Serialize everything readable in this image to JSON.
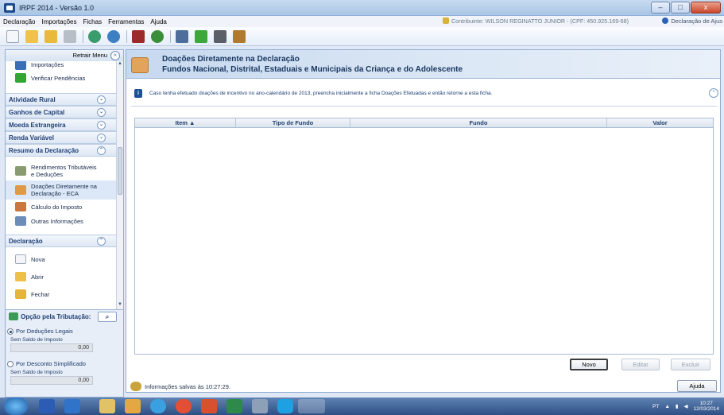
{
  "window": {
    "title": "IRPF 2014 - Versão 1.0",
    "min": "–",
    "max": "□",
    "close": "x"
  },
  "menu": {
    "items": [
      "Declaração",
      "Importações",
      "Fichas",
      "Ferramentas",
      "Ajuda"
    ],
    "contribuinte": "Contribuinte: WILSON REGINATTO JUNIOR - (CPF: 450.925.169-68)",
    "declaracao_ajuste": "Declaração de Ajus"
  },
  "sidebar": {
    "retrair": "Retrair Menu",
    "top_items": [
      {
        "label": "Importações",
        "icon": "import-icon"
      },
      {
        "label": "Verificar Pendências",
        "icon": "checkmark-icon"
      }
    ],
    "groups": [
      {
        "label": "Atividade Rural",
        "chev": "⌄"
      },
      {
        "label": "Ganhos de Capital",
        "chev": "⌄"
      },
      {
        "label": "Moeda Estrangeira",
        "chev": "⌄"
      },
      {
        "label": "Renda Variável",
        "chev": "⌄"
      },
      {
        "label": "Resumo da Declaração",
        "chev": "⌃"
      }
    ],
    "resumo_items": [
      {
        "label1": "Rendimentos Tributáveis",
        "label2": "e Deduções"
      },
      {
        "label1": "Doações Diretamente na",
        "label2": "Declaração - ECA"
      },
      {
        "label1": "Cálculo do Imposto",
        "label2": ""
      },
      {
        "label1": "Outras Informações",
        "label2": ""
      }
    ],
    "declaracao_group": {
      "label": "Declaração",
      "chev": "⌃"
    },
    "declaracao_items": [
      "Nova",
      "Abrir",
      "Fechar"
    ],
    "opcao": {
      "title": "Opção pela Tributação:",
      "option1": "Por Deduções Legais",
      "option2": "Por Desconto Simplificado",
      "saldo_label": "Sem Saldo de Imposto",
      "saldo1": "0,00",
      "saldo2": "0,00"
    }
  },
  "main": {
    "title1": "Doações Diretamente na Declaração",
    "title2": "Fundos Nacional, Distrital, Estaduais e Municipais da Criança e do Adolescente",
    "info": "Caso tenha efetuado doações de incentivo no ano-calendário de 2013, preencha inicialmente a ficha Doações Efetuadas e então retorne a esta ficha.",
    "columns": [
      "Item ▲",
      "Tipo de Fundo",
      "Fundo",
      "Valor"
    ],
    "rows": [],
    "buttons": {
      "novo": "Novo",
      "editar": "Editar",
      "excluir": "Excluir",
      "ajuda": "Ajuda"
    }
  },
  "status": {
    "text": "Informações salvas às 10:27:29."
  },
  "taskbar": {
    "lang": "PT",
    "time": "10:27",
    "date": "12/03/2014"
  },
  "colors": {
    "accent": "#1f3e6d",
    "taskbar": "#2e4f84"
  }
}
